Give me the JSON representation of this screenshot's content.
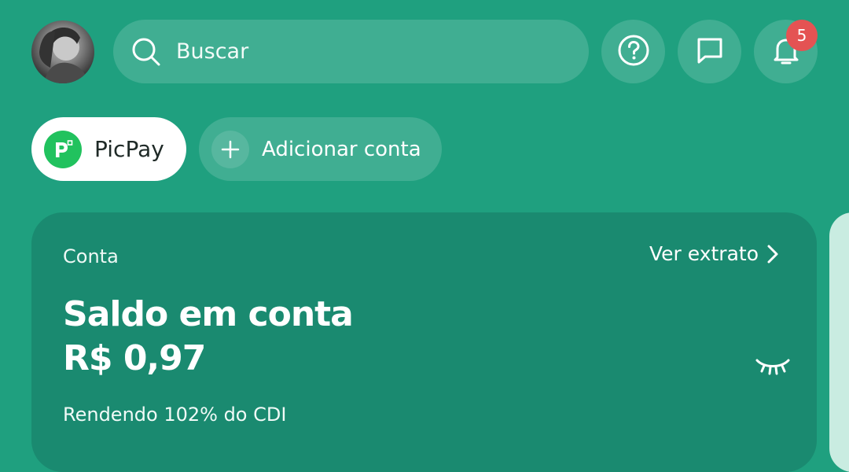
{
  "header": {
    "search_placeholder": "Buscar",
    "notifications_count": "5"
  },
  "accounts": {
    "active_label": "PicPay",
    "add_label": "Adicionar conta"
  },
  "card": {
    "section_label": "Conta",
    "statement_link": "Ver extrato",
    "balance_title": "Saldo em conta",
    "balance_value": "R$ 0,97",
    "yield_text": "Rendendo 102% do CDI"
  },
  "icons": {
    "search": "search-icon",
    "help": "help-circle-icon",
    "chat": "chat-icon",
    "bell": "bell-icon",
    "plus": "plus-icon",
    "chevron": "chevron-right-icon",
    "eye_closed": "eye-closed-icon"
  },
  "colors": {
    "background": "#1fa07f",
    "card": "#1a8a70",
    "badge": "#e45353",
    "brand": "#21c25e"
  }
}
